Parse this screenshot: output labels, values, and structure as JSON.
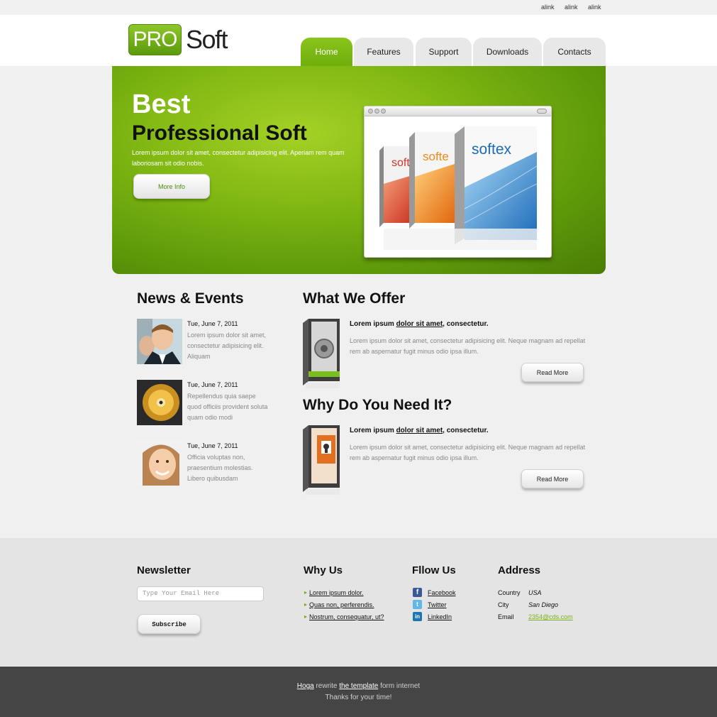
{
  "toplinks": [
    "alink",
    "alink",
    "alink"
  ],
  "logo": {
    "pro": "PRO",
    "soft": "Soft"
  },
  "nav": {
    "tabs": [
      "Home",
      "Features",
      "Support",
      "Downloads",
      "Contacts"
    ],
    "active": "Home"
  },
  "hero": {
    "title1": "Best",
    "title2": "Professional Soft",
    "text": "Lorem ipsum dolor sit amet, consectetur adipisicing elit. Aperiam rem quam laboriosam sit odio nobis.",
    "button": "More Info",
    "boxes": [
      "soft",
      "softe",
      "softex"
    ]
  },
  "news": {
    "title": "News & Events",
    "items": [
      {
        "date": "Tue, June 7, 2011",
        "text": "Lorem ipsum dolor sit amet, consectetur adipisicing elit. Aliquam"
      },
      {
        "date": "Tue, June 7, 2011",
        "text": "Repellendus quia saepe quod officiis provident soluta quam odio modi"
      },
      {
        "date": "Tue, June 7, 2011",
        "text": "Officia voluptas non, praesentium molestias. Libero quibusdam"
      }
    ]
  },
  "offer": {
    "title": "What We Offer",
    "strong_a": "Lorem ipsum ",
    "strong_link": "dolor sit amet",
    "strong_b": ", consectetur.",
    "text": "Lorem ipsum dolor sit amet, consectetur adipisicing elit. Neque magnam ad repellat rem ab aspernatur fugit minus odio ipsa illum.",
    "button": "Read More"
  },
  "need": {
    "title": "Why Do You Need It?",
    "strong_a": "Lorem ipsum ",
    "strong_link": "dolor sit amet",
    "strong_b": ", consectetur.",
    "text": "Lorem ipsum dolor sit amet, consectetur adipisicing elit. Neque magnam ad repellat rem ab aspernatur fugit minus odio ipsa illum.",
    "button": "Read More"
  },
  "footer": {
    "newsletter": {
      "title": "Newsletter",
      "placeholder": "Type Your Email Here",
      "button": "Subscribe"
    },
    "why": {
      "title": "Why Us",
      "links": [
        "Lorem ipsum dolor.",
        "Quas non, perferendis.",
        "Nostrum, consequatur, ut?"
      ]
    },
    "follow": {
      "title": "Fllow Us",
      "links": [
        "Facebook",
        "Twitter",
        "LinkedIn"
      ]
    },
    "address": {
      "title": "Address",
      "country_k": "Country",
      "country_v": "USA",
      "city_k": "City",
      "city_v": "San Diego",
      "email_k": "Email",
      "email_v": "2354@cds.com"
    }
  },
  "bottom": {
    "link1": "Hoga",
    "mid1": " rewrite ",
    "link2": "the template",
    "mid2": " form internet",
    "line2": "Thanks for your time!"
  },
  "colors": {
    "brand": "#7ab317",
    "footer_bg": "#e4e4e4",
    "bottom_bg": "#454545"
  }
}
